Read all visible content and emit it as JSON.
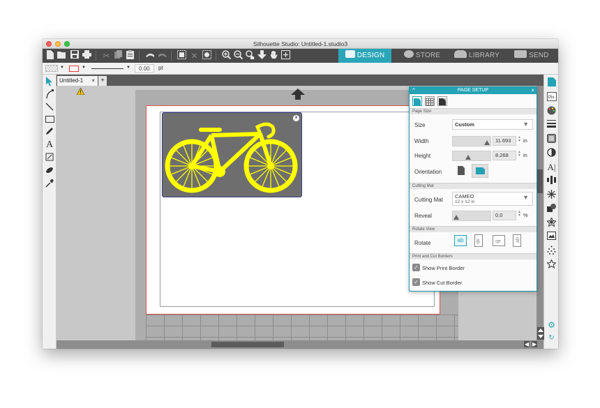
{
  "window": {
    "title": "Silhouette Studio: Untitled-1.studio3"
  },
  "toolbar": {
    "nav": {
      "design": "DESIGN",
      "store": "STORE",
      "library": "LIBRARY",
      "send": "SEND"
    }
  },
  "propbar": {
    "line_width": "0.00",
    "line_unit": "pt"
  },
  "tabs": {
    "doc_name": "Untitled-1",
    "close": "×",
    "add": "+"
  },
  "panel": {
    "title": "PAGE SETUP",
    "collapse": "^",
    "close": "×",
    "sections": {
      "page_size": "Page Size",
      "cutting_mat": "Cutting Mat",
      "rotate_view": "Rotate View",
      "borders": "Print and Cut Borders"
    },
    "size_label": "Size",
    "size_value": "Custom",
    "width_label": "Width",
    "width_value": "11.693",
    "width_unit": "in",
    "height_label": "Height",
    "height_value": "8.268",
    "height_unit": "in",
    "orientation_label": "Orientation",
    "mat_label": "Cutting Mat",
    "mat_name": "CAMEO",
    "mat_size": "12 x 12 in",
    "reveal_label": "Reveal",
    "reveal_value": "0.0",
    "reveal_unit": "%",
    "rotate_label": "Rotate",
    "rotate_ab": "ab",
    "show_print_border": "Show Print Border",
    "show_cut_border": "Show Cut Border"
  },
  "colors": {
    "accent": "#24a3b5",
    "bike": "#ffff00",
    "design_bg": "#6e6e6e"
  }
}
